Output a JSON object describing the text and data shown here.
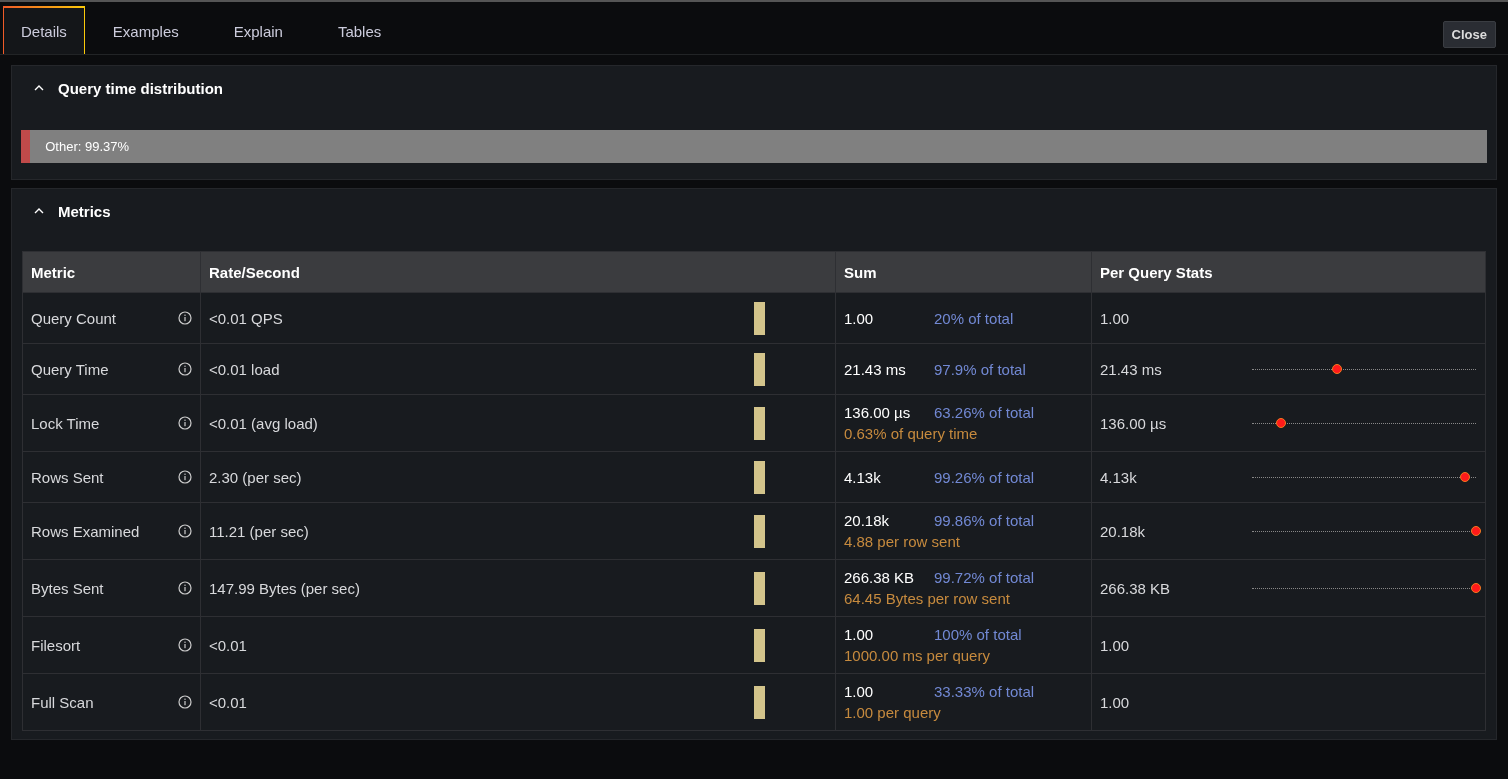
{
  "tabs": [
    {
      "label": "Details",
      "selected": true
    },
    {
      "label": "Examples",
      "selected": false
    },
    {
      "label": "Explain",
      "selected": false
    },
    {
      "label": "Tables",
      "selected": false
    }
  ],
  "close_button": "Close",
  "distribution": {
    "title": "Query time distribution",
    "expanded": true,
    "segments": [
      {
        "color": "#c04a4a",
        "level": 0.0063
      },
      {
        "label": "Other: 99.37%",
        "color": "#808080",
        "level": 0.9937
      }
    ]
  },
  "metrics": {
    "title": "Metrics",
    "expanded": true,
    "columns": [
      "Metric",
      "Rate/Second",
      "Sum",
      "Per Query Stats"
    ],
    "rows": [
      {
        "metric": "Query Count",
        "rate": "<0.01 QPS",
        "sum": "1.00",
        "share": "20% of total",
        "per_query": "1.00"
      },
      {
        "metric": "Query Time",
        "rate": "<0.01 load",
        "sum": "21.43 ms",
        "share": "97.9% of total",
        "per_query": "21.43 ms",
        "level": 0.38
      },
      {
        "metric": "Lock Time",
        "rate": "<0.01 (avg load)",
        "sum": "136.00 µs",
        "share": "63.26% of total",
        "note": "0.63% of query time",
        "per_query": "136.00 µs",
        "level": 0.13
      },
      {
        "metric": "Rows Sent",
        "rate": "2.30 (per sec)",
        "sum": "4.13k",
        "share": "99.26% of total",
        "per_query": "4.13k",
        "level": 0.95
      },
      {
        "metric": "Rows Examined",
        "rate": "11.21 (per sec)",
        "sum": "20.18k",
        "share": "99.86% of total",
        "note": "4.88 per row sent",
        "per_query": "20.18k",
        "level": 1.0
      },
      {
        "metric": "Bytes Sent",
        "rate": "147.99 Bytes (per sec)",
        "sum": "266.38 KB",
        "share": "99.72% of total",
        "note": "64.45 Bytes per row sent",
        "per_query": "266.38 KB",
        "level": 1.0
      },
      {
        "metric": "Filesort",
        "rate": "<0.01",
        "sum": "1.00",
        "share": "100% of total",
        "note": "1000.00 ms per query",
        "per_query": "1.00"
      },
      {
        "metric": "Full Scan",
        "rate": "<0.01",
        "sum": "1.00",
        "share": "33.33% of total",
        "note": "1.00 per query",
        "per_query": "1.00"
      }
    ]
  }
}
